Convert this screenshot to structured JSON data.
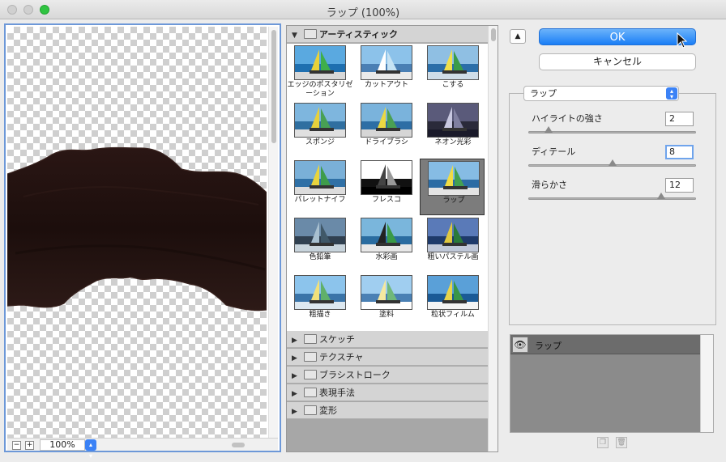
{
  "window": {
    "title": "ラップ (100%)"
  },
  "preview": {
    "zoom": "100%",
    "minus": "−",
    "plus": "+",
    "zoom_dropdown_icon": "updown-arrows-icon"
  },
  "filter_gallery": {
    "expanded_category": "アーティスティック",
    "items": [
      {
        "label": "エッジのポスタリゼーション"
      },
      {
        "label": "カットアウト"
      },
      {
        "label": "こする"
      },
      {
        "label": "スポンジ"
      },
      {
        "label": "ドライブラシ"
      },
      {
        "label": "ネオン光彩"
      },
      {
        "label": "パレットナイフ"
      },
      {
        "label": "フレスコ"
      },
      {
        "label": "ラップ",
        "selected": true
      },
      {
        "label": "色鉛筆"
      },
      {
        "label": "水彩画"
      },
      {
        "label": "粗いパステル画"
      },
      {
        "label": "粗描き"
      },
      {
        "label": "塗料"
      },
      {
        "label": "粒状フィルム"
      }
    ],
    "collapsed_categories": [
      "スケッチ",
      "テクスチャ",
      "ブラシストローク",
      "表現手法",
      "変形"
    ]
  },
  "buttons": {
    "ok": "OK",
    "cancel": "キャンセル",
    "collapse": "▲"
  },
  "filter_select": {
    "value": "ラップ"
  },
  "params": [
    {
      "label": "ハイライトの強さ",
      "value": "2",
      "slider_fraction": 0.12
    },
    {
      "label": "ディテール",
      "value": "8",
      "slider_fraction": 0.5
    },
    {
      "label": "滑らかさ",
      "value": "12",
      "slider_fraction": 0.79
    }
  ],
  "layers": {
    "name": "ラップ"
  },
  "colors": {
    "accent": "#1a7ef6",
    "shape_fill": "#1c0e0c",
    "selected_bg": "#7c7c7c"
  }
}
